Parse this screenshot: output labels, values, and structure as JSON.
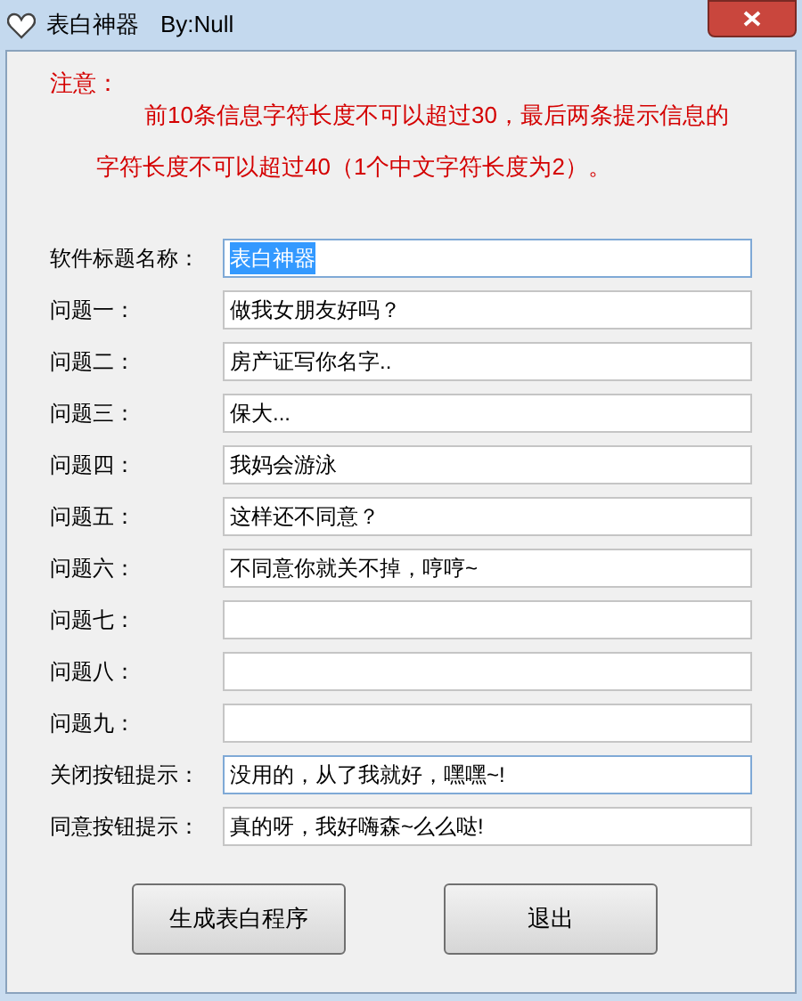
{
  "window": {
    "title": "表白神器",
    "author": "By:Null"
  },
  "notice": {
    "heading": "注意：",
    "lines": [
      "前10条信息字符长度不可以超过30，最后两条提示信息的",
      "字符长度不可以超过40（1个中文字符长度为2）。"
    ]
  },
  "fields": [
    {
      "label": "软件标题名称：",
      "value": "表白神器",
      "text_selected": true,
      "focused": true
    },
    {
      "label": "问题一：",
      "value": "做我女朋友好吗？",
      "text_selected": false,
      "focused": false
    },
    {
      "label": "问题二：",
      "value": "房产证写你名字..",
      "text_selected": false,
      "focused": false
    },
    {
      "label": "问题三：",
      "value": "保大...",
      "text_selected": false,
      "focused": false
    },
    {
      "label": "问题四：",
      "value": "我妈会游泳",
      "text_selected": false,
      "focused": false
    },
    {
      "label": "问题五：",
      "value": "这样还不同意？",
      "text_selected": false,
      "focused": false
    },
    {
      "label": "问题六：",
      "value": "不同意你就关不掉，哼哼~",
      "text_selected": false,
      "focused": false
    },
    {
      "label": "问题七：",
      "focused": false
    },
    {
      "label": "问题八：",
      "focused": false
    },
    {
      "label": "问题九：",
      "focused": false
    },
    {
      "label": "关闭按钮提示：",
      "value": "没用的，从了我就好，嘿嘿~!",
      "text_selected": false,
      "focused": true
    },
    {
      "label": "同意按钮提示：",
      "value": "真的呀，我好嗨森~么么哒!",
      "text_selected": false,
      "focused": false
    }
  ],
  "buttons": [
    "生成表白程序",
    "退出"
  ]
}
